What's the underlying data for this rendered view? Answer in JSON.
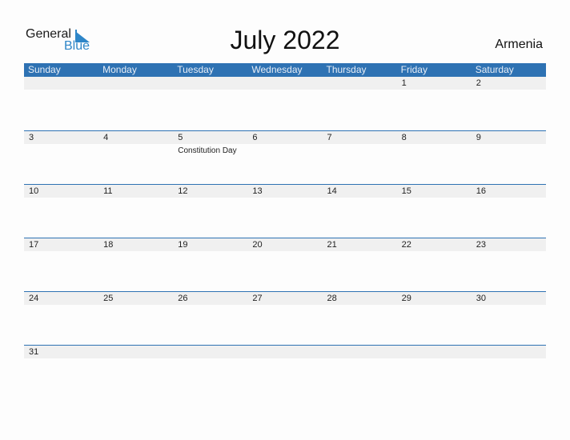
{
  "logo": {
    "general": "General",
    "blue": "Blue"
  },
  "header": {
    "title": "July 2022",
    "country": "Armenia"
  },
  "colors": {
    "accent": "#2e72b3",
    "logo_blue": "#2e86c8",
    "strip": "#f0f0f0"
  },
  "weekdays": [
    "Sunday",
    "Monday",
    "Tuesday",
    "Wednesday",
    "Thursday",
    "Friday",
    "Saturday"
  ],
  "weeks": [
    [
      {
        "day": ""
      },
      {
        "day": ""
      },
      {
        "day": ""
      },
      {
        "day": ""
      },
      {
        "day": ""
      },
      {
        "day": "1"
      },
      {
        "day": "2"
      }
    ],
    [
      {
        "day": "3"
      },
      {
        "day": "4"
      },
      {
        "day": "5",
        "holiday": "Constitution Day"
      },
      {
        "day": "6"
      },
      {
        "day": "7"
      },
      {
        "day": "8"
      },
      {
        "day": "9"
      }
    ],
    [
      {
        "day": "10"
      },
      {
        "day": "11"
      },
      {
        "day": "12"
      },
      {
        "day": "13"
      },
      {
        "day": "14"
      },
      {
        "day": "15"
      },
      {
        "day": "16"
      }
    ],
    [
      {
        "day": "17"
      },
      {
        "day": "18"
      },
      {
        "day": "19"
      },
      {
        "day": "20"
      },
      {
        "day": "21"
      },
      {
        "day": "22"
      },
      {
        "day": "23"
      }
    ],
    [
      {
        "day": "24"
      },
      {
        "day": "25"
      },
      {
        "day": "26"
      },
      {
        "day": "27"
      },
      {
        "day": "28"
      },
      {
        "day": "29"
      },
      {
        "day": "30"
      }
    ],
    [
      {
        "day": "31"
      },
      {
        "day": ""
      },
      {
        "day": ""
      },
      {
        "day": ""
      },
      {
        "day": ""
      },
      {
        "day": ""
      },
      {
        "day": ""
      }
    ]
  ]
}
